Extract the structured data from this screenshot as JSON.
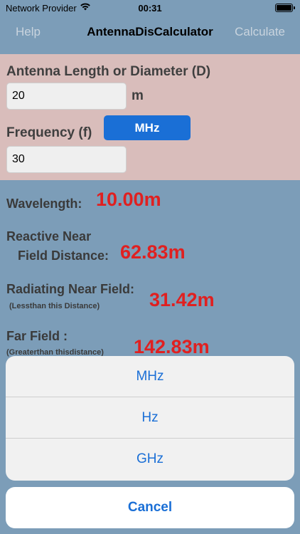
{
  "status_bar": {
    "carrier": "Network Provider",
    "time": "00:31",
    "wifi_icon": "wifi-icon",
    "battery_icon": "battery-icon"
  },
  "navbar": {
    "left": "Help",
    "title": "AntennaDisCalculator",
    "right": "Calculate"
  },
  "inputs": {
    "antenna_label": "Antenna Length or Diameter (D)",
    "antenna_value": "20",
    "antenna_unit": "m",
    "frequency_label": "Frequency (f)",
    "frequency_unit_button": "MHz",
    "frequency_value": "30"
  },
  "results": {
    "wavelength_label": "Wavelength:",
    "wavelength_value": "10.00m",
    "reactive_label_1": "Reactive Near",
    "reactive_label_2": "Field Distance:",
    "reactive_value": "62.83m",
    "radiating_label": "Radiating Near Field:",
    "radiating_sub": "(Lessthan this Distance)",
    "radiating_value": "31.42m",
    "far_label": "Far Field :",
    "far_sub": "(Greaterthan thisdistance)",
    "far_value": "142.83m"
  },
  "action_sheet": {
    "options": [
      "MHz",
      "Hz",
      "GHz"
    ],
    "cancel": "Cancel"
  },
  "colors": {
    "background": "#7c9db8",
    "input_panel": "#d9bdbb",
    "accent_blue": "#1a6fd6",
    "result_red": "#e02020"
  }
}
